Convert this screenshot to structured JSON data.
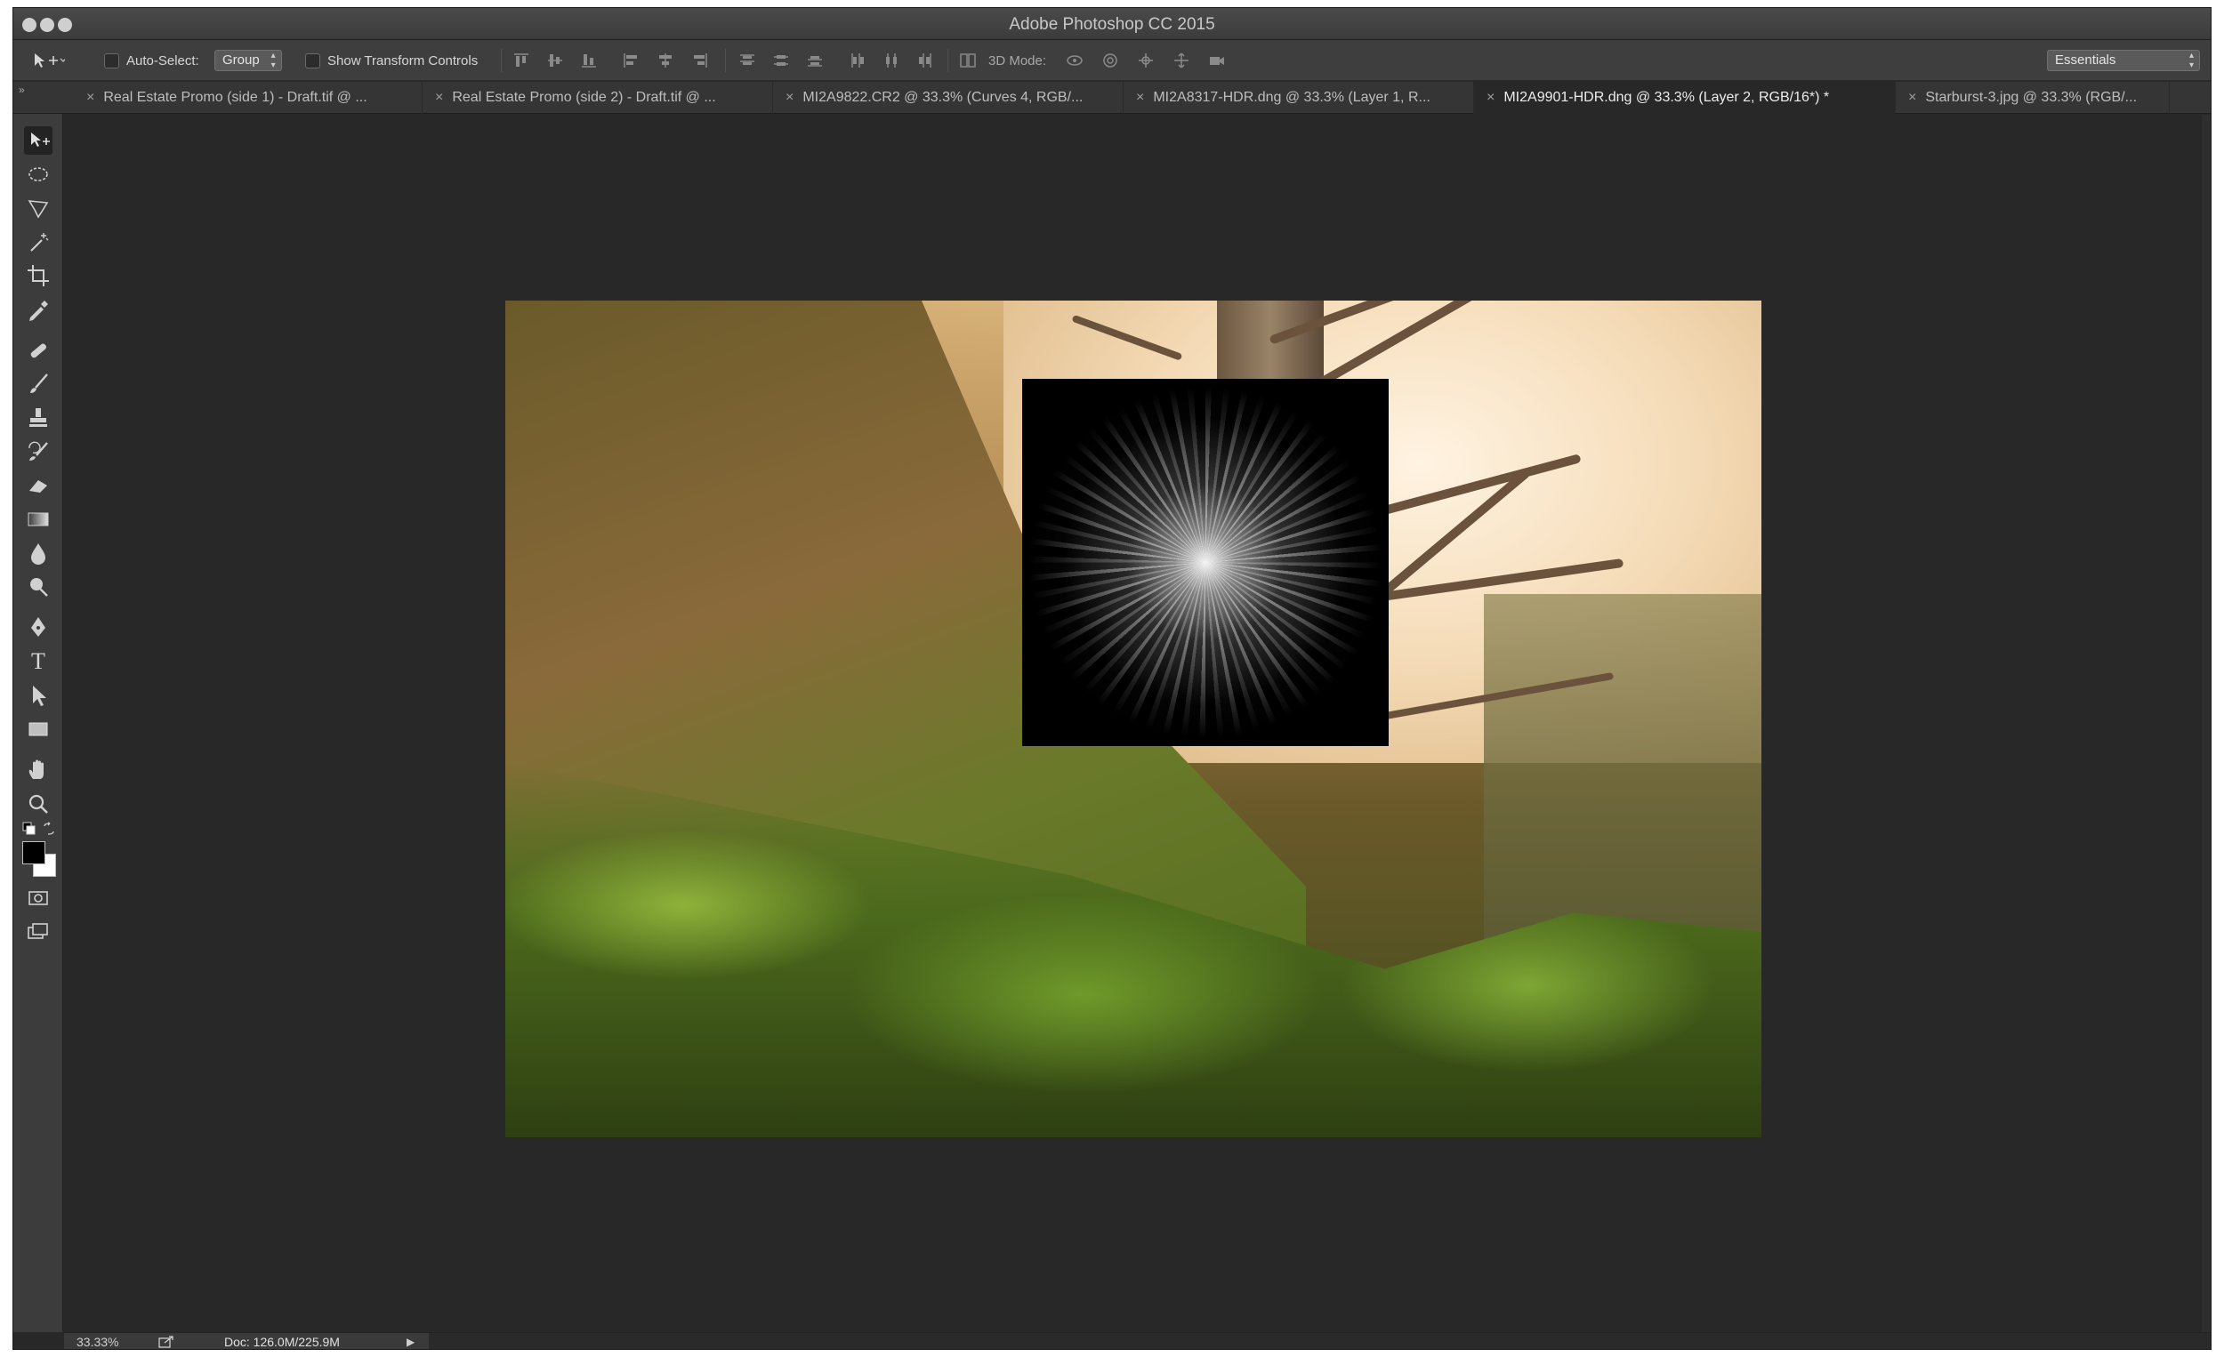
{
  "app": {
    "title": "Adobe Photoshop CC 2015"
  },
  "options_bar": {
    "auto_select_label": "Auto-Select:",
    "auto_select_checked": false,
    "auto_select_mode": "Group",
    "show_transform_label": "Show Transform Controls",
    "show_transform_checked": false,
    "mode_3d_label": "3D Mode:",
    "workspace": "Essentials"
  },
  "tabs": [
    {
      "label": "Real Estate Promo (side 1) - Draft.tif @ ...",
      "active": false
    },
    {
      "label": "Real Estate Promo (side 2) - Draft.tif @ ...",
      "active": false
    },
    {
      "label": "MI2A9822.CR2 @ 33.3% (Curves 4, RGB/...",
      "active": false
    },
    {
      "label": "MI2A8317-HDR.dng @ 33.3% (Layer 1, R...",
      "active": false
    },
    {
      "label": "MI2A9901-HDR.dng @ 33.3% (Layer 2, RGB/16*) *",
      "active": true
    },
    {
      "label": "Starburst-3.jpg @ 33.3% (RGB/...",
      "active": false
    }
  ],
  "tools": [
    {
      "name": "move-tool-icon",
      "active": true
    },
    {
      "name": "elliptical-marquee-tool-icon",
      "active": false
    },
    {
      "name": "polygonal-lasso-tool-icon",
      "active": false
    },
    {
      "name": "magic-wand-tool-icon",
      "active": false
    },
    {
      "name": "crop-tool-icon",
      "active": false
    },
    {
      "name": "eyedropper-tool-icon",
      "active": false
    },
    {
      "name": "healing-brush-tool-icon",
      "active": false
    },
    {
      "name": "brush-tool-icon",
      "active": false
    },
    {
      "name": "clone-stamp-tool-icon",
      "active": false
    },
    {
      "name": "history-brush-tool-icon",
      "active": false
    },
    {
      "name": "eraser-tool-icon",
      "active": false
    },
    {
      "name": "gradient-tool-icon",
      "active": false
    },
    {
      "name": "blur-tool-icon",
      "active": false
    },
    {
      "name": "dodge-tool-icon",
      "active": false
    },
    {
      "name": "pen-tool-icon",
      "active": false
    },
    {
      "name": "type-tool-icon",
      "active": false
    },
    {
      "name": "path-selection-tool-icon",
      "active": false
    },
    {
      "name": "rectangle-tool-icon",
      "active": false
    },
    {
      "name": "hand-tool-icon",
      "active": false
    },
    {
      "name": "zoom-tool-icon",
      "active": false
    }
  ],
  "type_tool_glyph": "T",
  "colors": {
    "foreground": "#000000",
    "background": "#ffffff",
    "ui_bg": "#282828"
  },
  "status": {
    "zoom": "33.33%",
    "doc": "Doc: 126.0M/225.9M"
  }
}
